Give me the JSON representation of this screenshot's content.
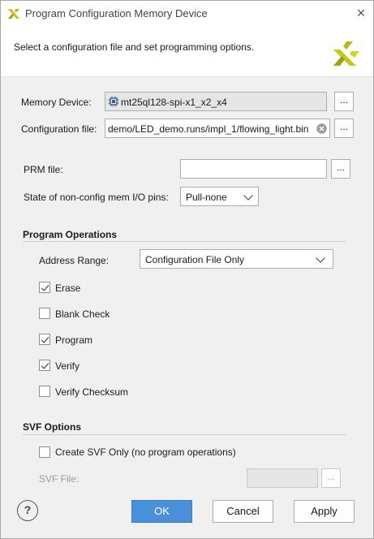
{
  "window": {
    "title": "Program Configuration Memory Device",
    "close_symbol": "×"
  },
  "description": "Select a configuration file and set programming options.",
  "memory_device": {
    "label": "Memory Device:",
    "value": "mt25ql128-spi-x1_x2_x4",
    "browse_label": "..."
  },
  "configuration_file": {
    "label": "Configuration file:",
    "value": "demo/LED_demo.runs/impl_1/flowing_light.bin",
    "browse_label": "..."
  },
  "prm_file": {
    "label": "PRM file:",
    "value": "",
    "browse_label": "..."
  },
  "nonconfig_pins": {
    "label": "State of non-config mem I/O pins:",
    "value": "Pull-none"
  },
  "program_operations": {
    "title": "Program Operations",
    "address_range_label": "Address Range:",
    "address_range_value": "Configuration File Only",
    "options": [
      {
        "label": "Erase",
        "checked": true
      },
      {
        "label": "Blank Check",
        "checked": false
      },
      {
        "label": "Program",
        "checked": true
      },
      {
        "label": "Verify",
        "checked": true
      },
      {
        "label": "Verify Checksum",
        "checked": false
      }
    ]
  },
  "svf_options": {
    "title": "SVF Options",
    "create_only_label": "Create SVF Only (no program operations)",
    "create_only_checked": false,
    "svf_file_label": "SVF File:",
    "svf_file_value": "",
    "browse_label": "..."
  },
  "buttons": {
    "help": "?",
    "ok": "OK",
    "cancel": "Cancel",
    "apply": "Apply"
  },
  "colors": {
    "accent": "#4a90d9",
    "logo_yellow": "#c8c41a"
  }
}
